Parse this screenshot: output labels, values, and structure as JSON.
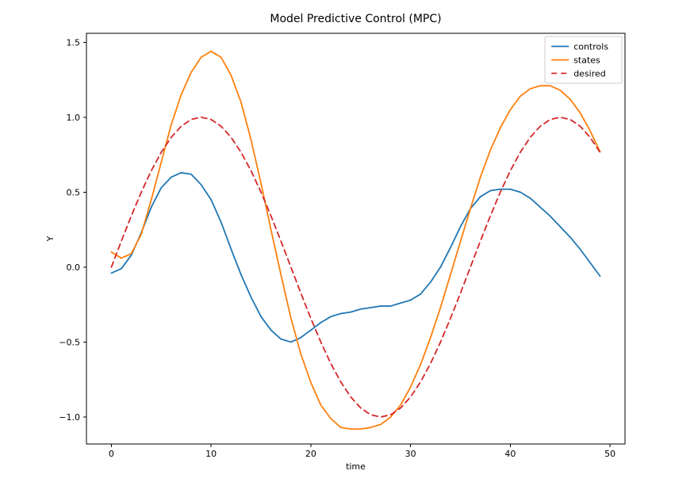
{
  "chart_data": {
    "type": "line",
    "title": "Model Predictive Control (MPC)",
    "xlabel": "time",
    "ylabel": "Y",
    "xlim": [
      -2.5,
      51.5
    ],
    "ylim": [
      -1.18,
      1.56
    ],
    "xticks": [
      0,
      10,
      20,
      30,
      40,
      50
    ],
    "xtick_labels": [
      "0",
      "10",
      "20",
      "30",
      "40",
      "50"
    ],
    "yticks": [
      -1.0,
      -0.5,
      0.0,
      0.5,
      1.0,
      1.5
    ],
    "ytick_labels": [
      "−1.0",
      "−0.5",
      "0.0",
      "0.5",
      "1.0",
      "1.5"
    ],
    "x": [
      0,
      1,
      2,
      3,
      4,
      5,
      6,
      7,
      8,
      9,
      10,
      11,
      12,
      13,
      14,
      15,
      16,
      17,
      18,
      19,
      20,
      21,
      22,
      23,
      24,
      25,
      26,
      27,
      28,
      29,
      30,
      31,
      32,
      33,
      34,
      35,
      36,
      37,
      38,
      39,
      40,
      41,
      42,
      43,
      44,
      45,
      46,
      47,
      48,
      49
    ],
    "series": [
      {
        "name": "controls",
        "color": "#1f77b4",
        "linestyle": "solid",
        "values": [
          -0.04,
          -0.01,
          0.08,
          0.23,
          0.4,
          0.53,
          0.6,
          0.63,
          0.62,
          0.55,
          0.45,
          0.3,
          0.12,
          -0.05,
          -0.2,
          -0.33,
          -0.42,
          -0.48,
          -0.5,
          -0.47,
          -0.42,
          -0.37,
          -0.33,
          -0.31,
          -0.3,
          -0.28,
          -0.27,
          -0.26,
          -0.26,
          -0.24,
          -0.22,
          -0.18,
          -0.1,
          0.0,
          0.13,
          0.27,
          0.39,
          0.47,
          0.51,
          0.52,
          0.52,
          0.5,
          0.46,
          0.4,
          0.34,
          0.27,
          0.2,
          0.12,
          0.03,
          -0.06
        ]
      },
      {
        "name": "states",
        "color": "#ff7f0e",
        "linestyle": "solid",
        "values": [
          0.1,
          0.06,
          0.09,
          0.22,
          0.45,
          0.7,
          0.95,
          1.15,
          1.3,
          1.4,
          1.44,
          1.4,
          1.28,
          1.1,
          0.85,
          0.56,
          0.25,
          -0.05,
          -0.34,
          -0.58,
          -0.77,
          -0.92,
          -1.01,
          -1.07,
          -1.08,
          -1.08,
          -1.07,
          -1.05,
          -1.0,
          -0.92,
          -0.8,
          -0.65,
          -0.47,
          -0.27,
          -0.05,
          0.17,
          0.39,
          0.6,
          0.78,
          0.93,
          1.05,
          1.14,
          1.19,
          1.21,
          1.21,
          1.18,
          1.12,
          1.03,
          0.91,
          0.77
        ]
      },
      {
        "name": "desired",
        "color": "#d62728",
        "linestyle": "dashed",
        "values": [
          0.0,
          0.174,
          0.342,
          0.5,
          0.643,
          0.766,
          0.866,
          0.94,
          0.985,
          1.0,
          0.985,
          0.94,
          0.866,
          0.766,
          0.643,
          0.5,
          0.342,
          0.174,
          0.0,
          -0.174,
          -0.342,
          -0.5,
          -0.643,
          -0.766,
          -0.866,
          -0.94,
          -0.985,
          -1.0,
          -0.985,
          -0.94,
          -0.866,
          -0.766,
          -0.643,
          -0.5,
          -0.342,
          -0.174,
          0.0,
          0.174,
          0.342,
          0.5,
          0.643,
          0.766,
          0.866,
          0.94,
          0.985,
          1.0,
          0.985,
          0.94,
          0.866,
          0.766
        ]
      }
    ],
    "legend": {
      "position": "upper right",
      "entries": [
        "controls",
        "states",
        "desired"
      ]
    }
  }
}
